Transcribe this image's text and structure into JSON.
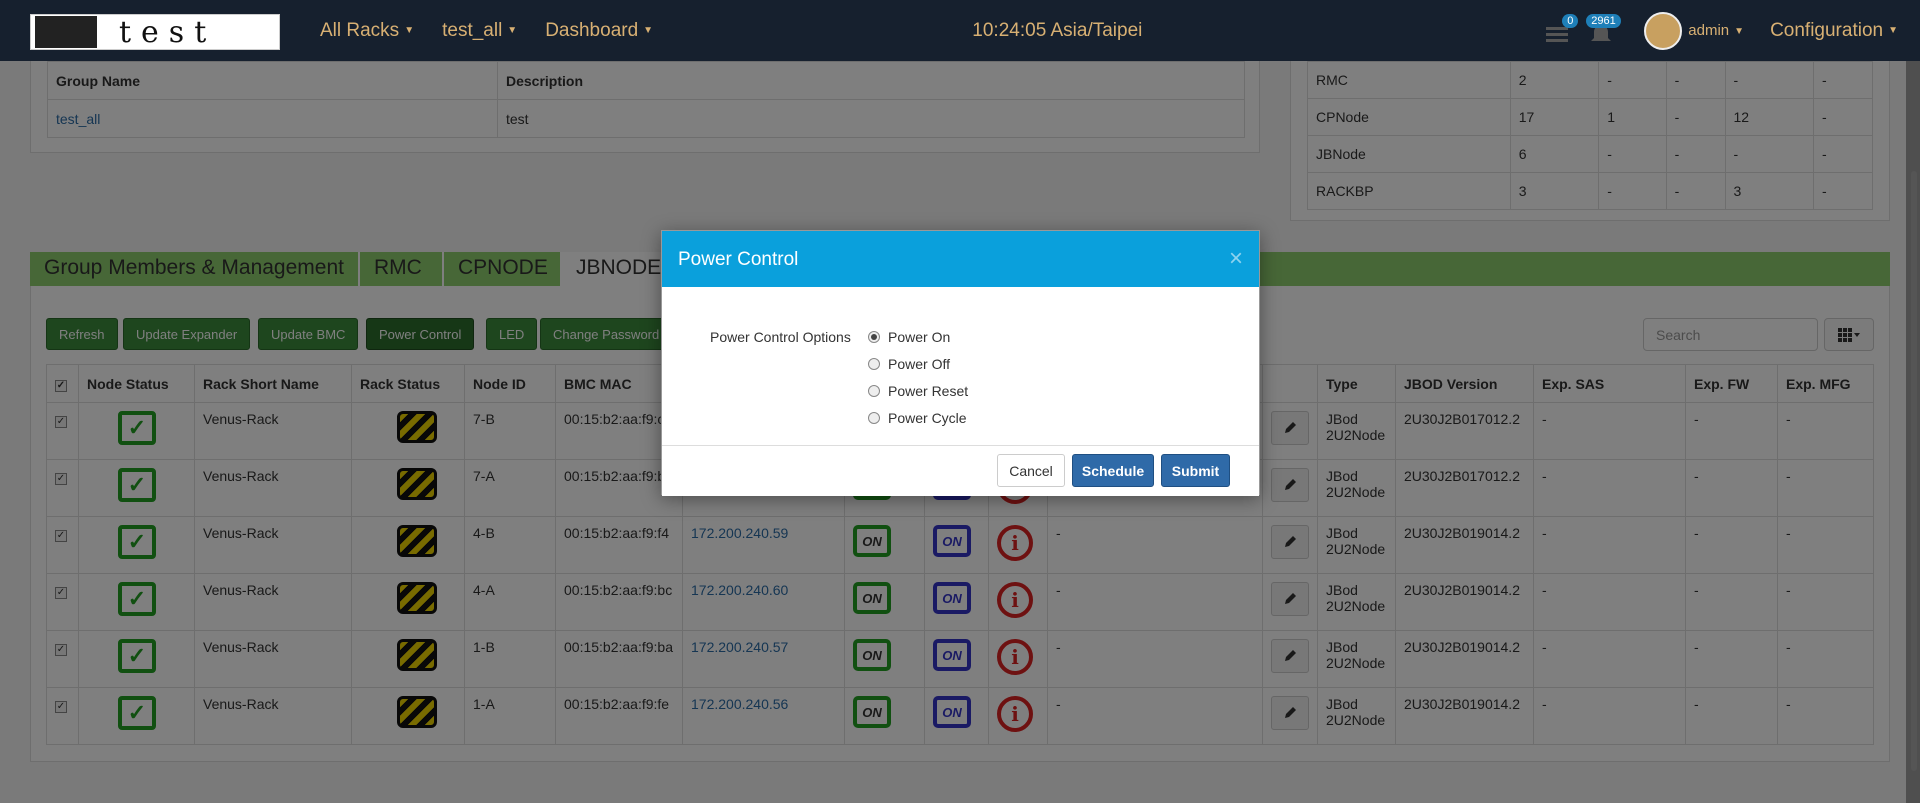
{
  "navbar": {
    "logo_text": "test",
    "menu": [
      {
        "label": "All Racks"
      },
      {
        "label": "test_all"
      },
      {
        "label": "Dashboard"
      }
    ],
    "clock": "10:24:05 Asia/Taipei",
    "messages_count": "0",
    "alerts_count": "2961",
    "user": "admin",
    "config": "Configuration"
  },
  "group_table": {
    "headers": [
      "Group Name",
      "Description"
    ],
    "row": [
      "test_all",
      "test"
    ]
  },
  "summary_table": {
    "rows": [
      [
        "RMC",
        "2",
        "-",
        "-",
        "-",
        "-"
      ],
      [
        "CPNode",
        "17",
        "1",
        "-",
        "12",
        "-"
      ],
      [
        "JBNode",
        "6",
        "-",
        "-",
        "-",
        "-"
      ],
      [
        "RACKBP",
        "3",
        "-",
        "-",
        "3",
        "-"
      ]
    ]
  },
  "tabs": [
    "Group Members & Management",
    "RMC",
    "CPNODE",
    "JBNODE"
  ],
  "toolbar": {
    "buttons": [
      "Refresh",
      "Update Expander",
      "Update BMC",
      "Power Control",
      "LED",
      "Change Password"
    ],
    "search_placeholder": "Search"
  },
  "members": {
    "headers": [
      "Node Status",
      "Rack Short Name",
      "Rack Status",
      "Node ID",
      "BMC MAC",
      "Type",
      "JBOD Version",
      "Exp. SAS",
      "Exp. FW",
      "Exp. MFG"
    ],
    "power_labels": {
      "green": "ON",
      "blue": "ON"
    },
    "rows": [
      {
        "rack": "Venus-Rack",
        "node": "7-B",
        "mac": "00:15:b2:aa:f9:c",
        "ip": "",
        "dash": "",
        "type": "JBod 2U2Node",
        "ver": "2U30J2B017012.2",
        "sas": "-",
        "fw": "-",
        "mfg": "-"
      },
      {
        "rack": "Venus-Rack",
        "node": "7-A",
        "mac": "00:15:b2:aa:f9:b",
        "ip": "",
        "dash": "",
        "type": "JBod 2U2Node",
        "ver": "2U30J2B017012.2",
        "sas": "-",
        "fw": "-",
        "mfg": "-"
      },
      {
        "rack": "Venus-Rack",
        "node": "4-B",
        "mac": "00:15:b2:aa:f9:f4",
        "ip": "172.200.240.59",
        "dash": "-",
        "type": "JBod 2U2Node",
        "ver": "2U30J2B019014.2",
        "sas": "-",
        "fw": "-",
        "mfg": "-"
      },
      {
        "rack": "Venus-Rack",
        "node": "4-A",
        "mac": "00:15:b2:aa:f9:bc",
        "ip": "172.200.240.60",
        "dash": "-",
        "type": "JBod 2U2Node",
        "ver": "2U30J2B019014.2",
        "sas": "-",
        "fw": "-",
        "mfg": "-"
      },
      {
        "rack": "Venus-Rack",
        "node": "1-B",
        "mac": "00:15:b2:aa:f9:ba",
        "ip": "172.200.240.57",
        "dash": "-",
        "type": "JBod 2U2Node",
        "ver": "2U30J2B019014.2",
        "sas": "-",
        "fw": "-",
        "mfg": "-"
      },
      {
        "rack": "Venus-Rack",
        "node": "1-A",
        "mac": "00:15:b2:aa:f9:fe",
        "ip": "172.200.240.56",
        "dash": "-",
        "type": "JBod 2U2Node",
        "ver": "2U30J2B019014.2",
        "sas": "-",
        "fw": "-",
        "mfg": "-"
      }
    ]
  },
  "modal": {
    "title": "Power Control",
    "options_label": "Power Control Options",
    "options": [
      "Power On",
      "Power Off",
      "Power Reset",
      "Power Cycle"
    ],
    "selected": "Power On",
    "cancel": "Cancel",
    "schedule": "Schedule",
    "submit": "Submit"
  },
  "colors": {
    "navbar": "#16202e",
    "nav_text": "#d8b073",
    "tab_green": "#8fcf6e",
    "button_green": "#3c8c3c",
    "modal_header": "#0aa0dc",
    "primary_blue": "#2f6aa8"
  }
}
